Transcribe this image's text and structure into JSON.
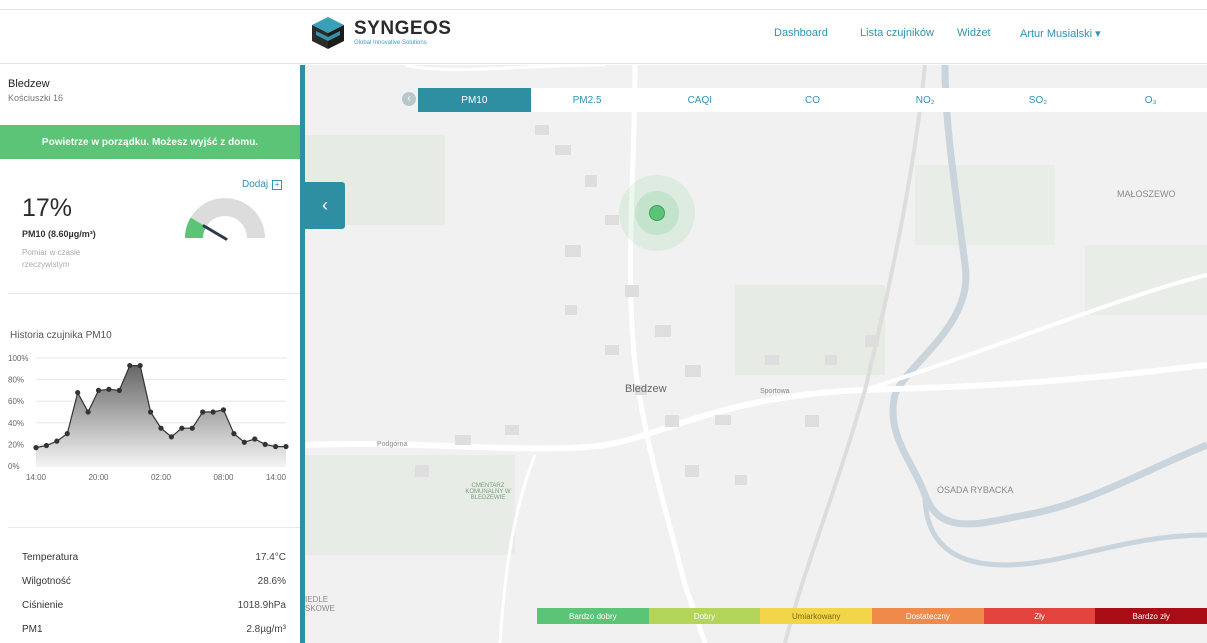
{
  "header": {
    "logo_name": "SYNGEOS",
    "logo_sub": "Global Innovative Solutions",
    "nav": [
      {
        "label": "Dashboard"
      },
      {
        "label": "Lista czujników"
      },
      {
        "label": "Widżet"
      },
      {
        "label": "Artur Musialski ▾"
      }
    ]
  },
  "sidebar": {
    "location_name": "Bledzew",
    "location_address": "Kościuszki 16",
    "status_banner": "Powietrze w porządku. Możesz wyjść z domu.",
    "add_label": "Dodaj",
    "percent": "17%",
    "pm_label": "PM10 (8.60µg/m³)",
    "realtime_note": "Pomiar w czasie rzeczywistym",
    "gauge_level": 0.17,
    "history_title": "Historia czujnika PM10",
    "stats": [
      {
        "label": "Temperatura",
        "value": "17.4°C"
      },
      {
        "label": "Wilgotność",
        "value": "28.6%"
      },
      {
        "label": "Ciśnienie",
        "value": "1018.9hPa"
      },
      {
        "label": "PM1",
        "value": "2.8µg/m³"
      }
    ]
  },
  "chart_data": {
    "type": "area",
    "title": "Historia czujnika PM10",
    "x_ticks": [
      "14:00",
      "20:00",
      "02:00",
      "08:00",
      "14:00"
    ],
    "y_ticks": [
      "0%",
      "20%",
      "40%",
      "60%",
      "80%",
      "100%"
    ],
    "ylim": [
      0,
      100
    ],
    "values": [
      17,
      19,
      23,
      30,
      68,
      50,
      70,
      71,
      70,
      93,
      93,
      50,
      35,
      27,
      35,
      35,
      50,
      50,
      52,
      30,
      22,
      25,
      20,
      18,
      18
    ],
    "grid": true
  },
  "map": {
    "tabs": [
      {
        "label": "PM10",
        "active": true
      },
      {
        "label": "PM2.5",
        "active": false
      },
      {
        "label": "CAQI",
        "active": false
      },
      {
        "label": "CO",
        "active": false
      },
      {
        "label": "NO₂",
        "active": false
      },
      {
        "label": "SO₂",
        "active": false
      },
      {
        "label": "O₃",
        "active": false
      }
    ],
    "town_label": "Bledzew",
    "labels": [
      "MAŁOSZEWO",
      "OSADA RYBACKA",
      "Sportowa",
      "Podgórna",
      "CMENTARZ KOMUNALNY W BLEDZEWIE",
      "IEDLE SKOWE"
    ],
    "sensor_color": "#5cc476",
    "legend": [
      {
        "label": "Bardzo dobry",
        "color": "#5cc476",
        "text_color": "#ffffff"
      },
      {
        "label": "Dobry",
        "color": "#b3d65a",
        "text_color": "#ffffff"
      },
      {
        "label": "Umiarkowany",
        "color": "#f3d54a",
        "text_color": "#7a6a10"
      },
      {
        "label": "Dostateczny",
        "color": "#f08a4b",
        "text_color": "#ffffff"
      },
      {
        "label": "Zły",
        "color": "#e2433c",
        "text_color": "#ffffff"
      },
      {
        "label": "Bardzo zły",
        "color": "#a80d16",
        "text_color": "#ffffff"
      }
    ]
  }
}
